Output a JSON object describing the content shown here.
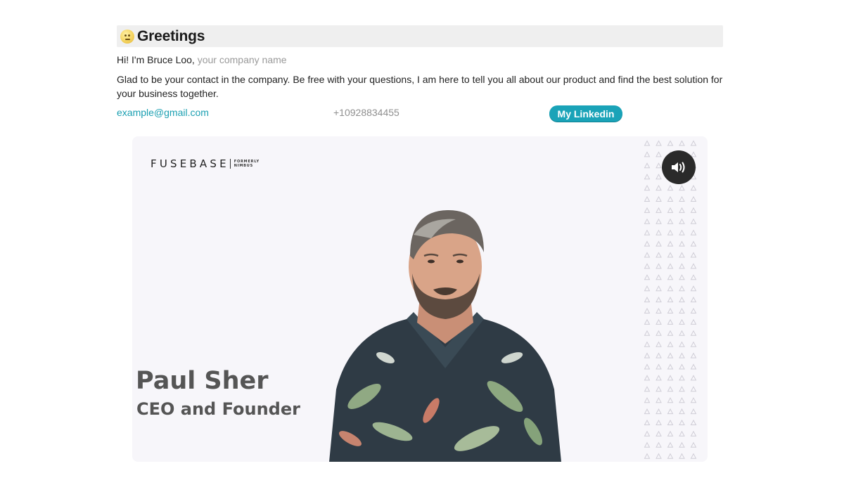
{
  "header": {
    "emoji_icon": "neutral-face-emoji",
    "title": "Greetings"
  },
  "intro": {
    "text": "Hi! I'm Bruce Loo,",
    "company_placeholder": "your company name"
  },
  "description": "Glad to be your contact in the company. Be free with your questions, I am here to tell you all about our product and find the best solution for your business together.",
  "contacts": {
    "email": "example@gmail.com",
    "phone": "+10928834455",
    "linkedin_label": "My Linkedin"
  },
  "video": {
    "logo_text": "FUSEBASE",
    "logo_sub_line1": "FORMERLY",
    "logo_sub_line2": "NIMBUS",
    "sound_icon": "speaker-volume-icon",
    "person_name": "Paul Sher",
    "person_role": "CEO and Founder"
  },
  "colors": {
    "accent": "#1aa3b8",
    "link": "#1a9fb1",
    "greeting_bar": "#efefef",
    "video_bg": "#f7f6fa"
  }
}
